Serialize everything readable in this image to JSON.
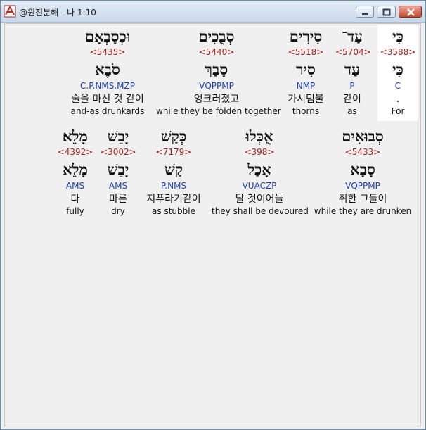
{
  "window": {
    "title": "@원전분해 - 나 1:10"
  },
  "lines": [
    [
      {
        "heb": "כִּי",
        "strong": "<3588>",
        "lemma": "כִּי",
        "morph": "C",
        "kor": ".",
        "eng": "For"
      },
      {
        "heb": "עַד־",
        "strong": "<5704>",
        "lemma": "עַד",
        "morph": "P",
        "kor": "같이",
        "eng": "as"
      },
      {
        "heb": "סִירִים",
        "strong": "<5518>",
        "lemma": "סִיר",
        "morph": "NMP",
        "kor": "가시덤불",
        "eng": "thorns"
      },
      {
        "heb": "סְבֻכִים",
        "strong": "<5440>",
        "lemma": "סָבַךְ",
        "morph": "VQPPMP",
        "kor": "엉크러졌고",
        "eng": "while they be folden together"
      },
      {
        "heb": "וּכְסָבְאָם",
        "strong": "<5435>",
        "lemma": "סֹבֶא",
        "morph": "C.P.NMS.MZP",
        "kor": "술을 마신 것 같이",
        "eng": "and-as drunkards"
      }
    ],
    [
      {
        "heb": "סְבוּאִים",
        "strong": "<5433>",
        "lemma": "סָבָא",
        "morph": "VQPPMP",
        "kor": "취한 그들이",
        "eng": "while they are drunken"
      },
      {
        "heb": "אֻכְּלוּ",
        "strong": "<398>",
        "lemma": "אָכַל",
        "morph": "VUACZP",
        "kor": "탈 것이어늘",
        "eng": "they shall be devoured"
      },
      {
        "heb": "כְּקַשׁ",
        "strong": "<7179>",
        "lemma": "קַשׁ",
        "morph": "P.NMS",
        "kor": "지푸라기같이",
        "eng": "as stubble"
      },
      {
        "heb": "יָבֵשׁ",
        "strong": "<3002>",
        "lemma": "יָבֵשׁ",
        "morph": "AMS",
        "kor": "마른",
        "eng": "dry"
      },
      {
        "heb": "מָלֵא׃",
        "strong": "<4392>",
        "lemma": "מָלֵא",
        "morph": "AMS",
        "kor": "다",
        "eng": "fully"
      }
    ]
  ]
}
